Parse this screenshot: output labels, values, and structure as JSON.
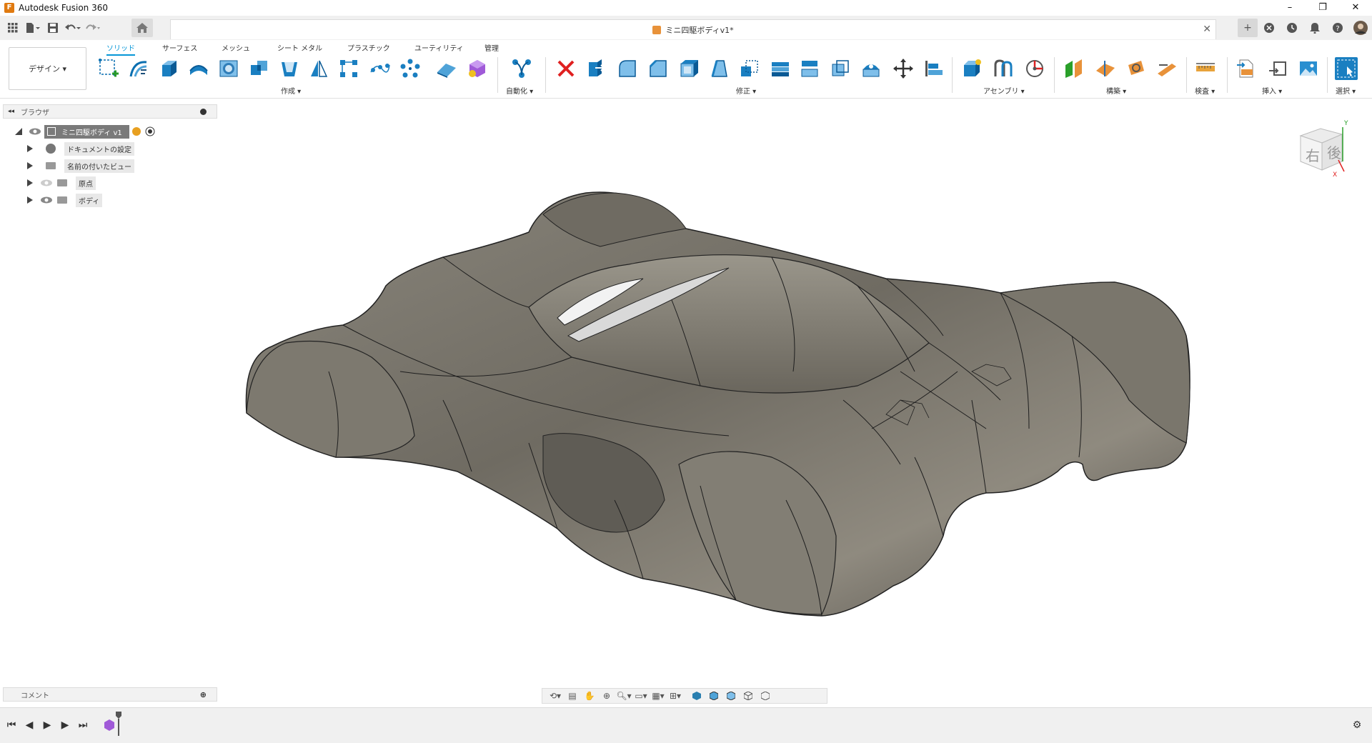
{
  "app": {
    "title": "Autodesk Fusion 360",
    "document_tab": "ミニ四駆ボディv1*"
  },
  "window_controls": {
    "minimize": "–",
    "restore": "❐",
    "close": "✕"
  },
  "workspace": {
    "label": "デザイン ▾"
  },
  "ribbon_tabs": [
    "ソリッド",
    "サーフェス",
    "メッシュ",
    "シート メタル",
    "プラスチック",
    "ユーティリティ",
    "管理"
  ],
  "ribbon_groups": {
    "create": "作成 ▾",
    "automate": "自動化 ▾",
    "modify": "修正 ▾",
    "assemble": "アセンブリ ▾",
    "construct": "構築 ▾",
    "inspect": "検査 ▾",
    "insert": "挿入 ▾",
    "select": "選択 ▾"
  },
  "browser": {
    "title": "ブラウザ",
    "root": "ミニ四駆ボディ v1",
    "items": [
      {
        "label": "ドキュメントの設定"
      },
      {
        "label": "名前の付いたビュー"
      },
      {
        "label": "原点"
      },
      {
        "label": "ボディ"
      }
    ]
  },
  "comment_panel": {
    "title": "コメント"
  },
  "viewcube": {
    "right": "右",
    "back": "後",
    "axis_x": "X",
    "axis_y": "Y"
  },
  "colors": {
    "accent": "#0696d7",
    "body": "#6f6b62",
    "delete": "#e02020",
    "orange": "#e8923a"
  }
}
